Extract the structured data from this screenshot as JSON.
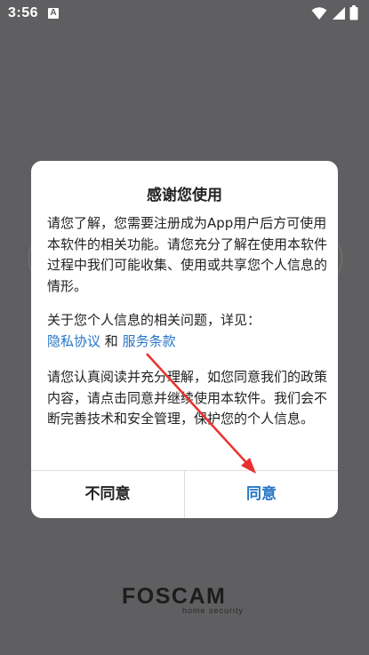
{
  "status_bar": {
    "time": "3:56",
    "notification_glyph": "A",
    "icons": [
      "wifi-icon",
      "signal-icon",
      "battery-icon"
    ]
  },
  "dialog": {
    "title": "感谢您使用",
    "paragraph1": "请您了解，您需要注册成为App用户后方可使用本软件的相关功能。请您充分了解在使用本软件过程中我们可能收集、使用或共享您个人信息的情形。",
    "paragraph2_prefix": "关于您个人信息的相关问题，详见：",
    "privacy_link": "隐私协议",
    "conjunction": " 和 ",
    "terms_link": "服务条款",
    "paragraph3": "请您认真阅读并充分理解，如您同意我们的政策内容，请点击同意并继续使用本软件。我们会不断完善技术和安全管理，保护您的个人信息。",
    "disagree_label": "不同意",
    "agree_label": "同意"
  },
  "brand": {
    "logo_text": "FOSCAM",
    "tagline": "home security"
  },
  "colors": {
    "background": "#5f5f61",
    "link": "#2676c6",
    "annotation_arrow": "#e8312e"
  }
}
